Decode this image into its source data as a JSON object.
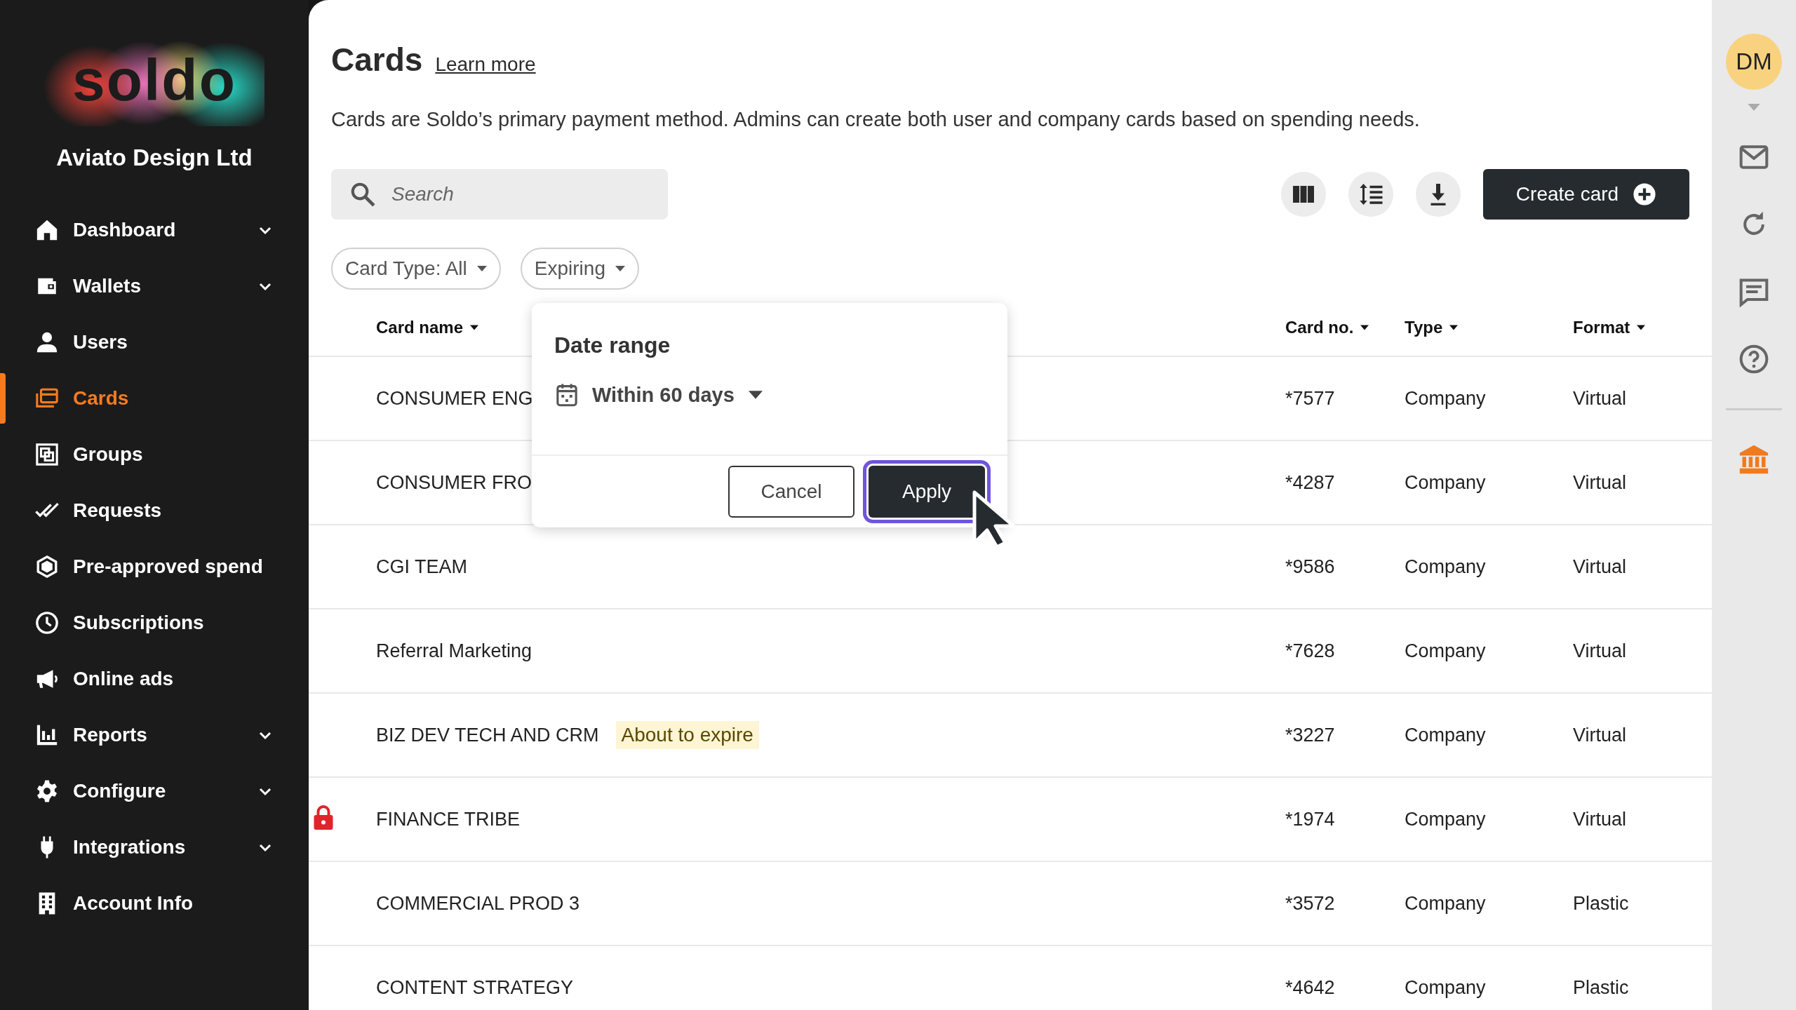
{
  "sidebar": {
    "logo": "soldo",
    "company": "Aviato Design Ltd",
    "items": [
      {
        "label": "Dashboard",
        "expandable": true,
        "selected": false
      },
      {
        "label": "Wallets",
        "expandable": true,
        "selected": false
      },
      {
        "label": "Users",
        "expandable": false,
        "selected": false
      },
      {
        "label": "Cards",
        "expandable": false,
        "selected": true
      },
      {
        "label": "Groups",
        "expandable": false,
        "selected": false
      },
      {
        "label": "Requests",
        "expandable": false,
        "selected": false
      },
      {
        "label": "Pre-approved spend",
        "expandable": false,
        "selected": false
      },
      {
        "label": "Subscriptions",
        "expandable": false,
        "selected": false
      },
      {
        "label": "Online ads",
        "expandable": false,
        "selected": false
      },
      {
        "label": "Reports",
        "expandable": true,
        "selected": false
      },
      {
        "label": "Configure",
        "expandable": true,
        "selected": false
      },
      {
        "label": "Integrations",
        "expandable": true,
        "selected": false
      },
      {
        "label": "Account Info",
        "expandable": false,
        "selected": false
      }
    ]
  },
  "page": {
    "title": "Cards",
    "learn_more": "Learn more",
    "description": "Cards are Soldo’s primary payment method. Admins can create both user and company cards based on spending needs."
  },
  "toolbar": {
    "search": {
      "placeholder": "Search"
    },
    "create_button": "Create card"
  },
  "filters": [
    {
      "label": "Card Type: All"
    },
    {
      "label": "Expiring"
    }
  ],
  "popup": {
    "title": "Date range",
    "range": "Within 60 days",
    "buttons": [
      {
        "label": "Cancel",
        "primary": false,
        "focused": false
      },
      {
        "label": "Apply",
        "primary": true,
        "focused": true
      }
    ]
  },
  "table": {
    "columns": [
      {
        "label": "Card name"
      },
      {
        "label": "Card no."
      },
      {
        "label": "Type"
      },
      {
        "label": "Format"
      }
    ],
    "rows": [
      {
        "name": "CONSUMER ENG",
        "locked": false,
        "card_no": "*7577",
        "type": "Company",
        "format": "Virtual"
      },
      {
        "name": "CONSUMER FRO",
        "locked": false,
        "card_no": "*4287",
        "type": "Company",
        "format": "Virtual"
      },
      {
        "name": "CGI TEAM",
        "locked": false,
        "card_no": "*9586",
        "type": "Company",
        "format": "Virtual"
      },
      {
        "name": "Referral Marketing",
        "locked": false,
        "card_no": "*7628",
        "type": "Company",
        "format": "Virtual"
      },
      {
        "name": "BIZ DEV TECH AND CRM",
        "badge": "About to expire",
        "locked": false,
        "card_no": "*3227",
        "type": "Company",
        "format": "Virtual"
      },
      {
        "name": "FINANCE TRIBE",
        "locked": true,
        "card_no": "*1974",
        "type": "Company",
        "format": "Virtual"
      },
      {
        "name": "COMMERCIAL PROD 3",
        "locked": false,
        "card_no": "*3572",
        "type": "Company",
        "format": "Plastic"
      },
      {
        "name": "CONTENT STRATEGY",
        "locked": false,
        "card_no": "*4642",
        "type": "Company",
        "format": "Plastic"
      }
    ]
  },
  "right_rail": {
    "avatar": "DM"
  }
}
